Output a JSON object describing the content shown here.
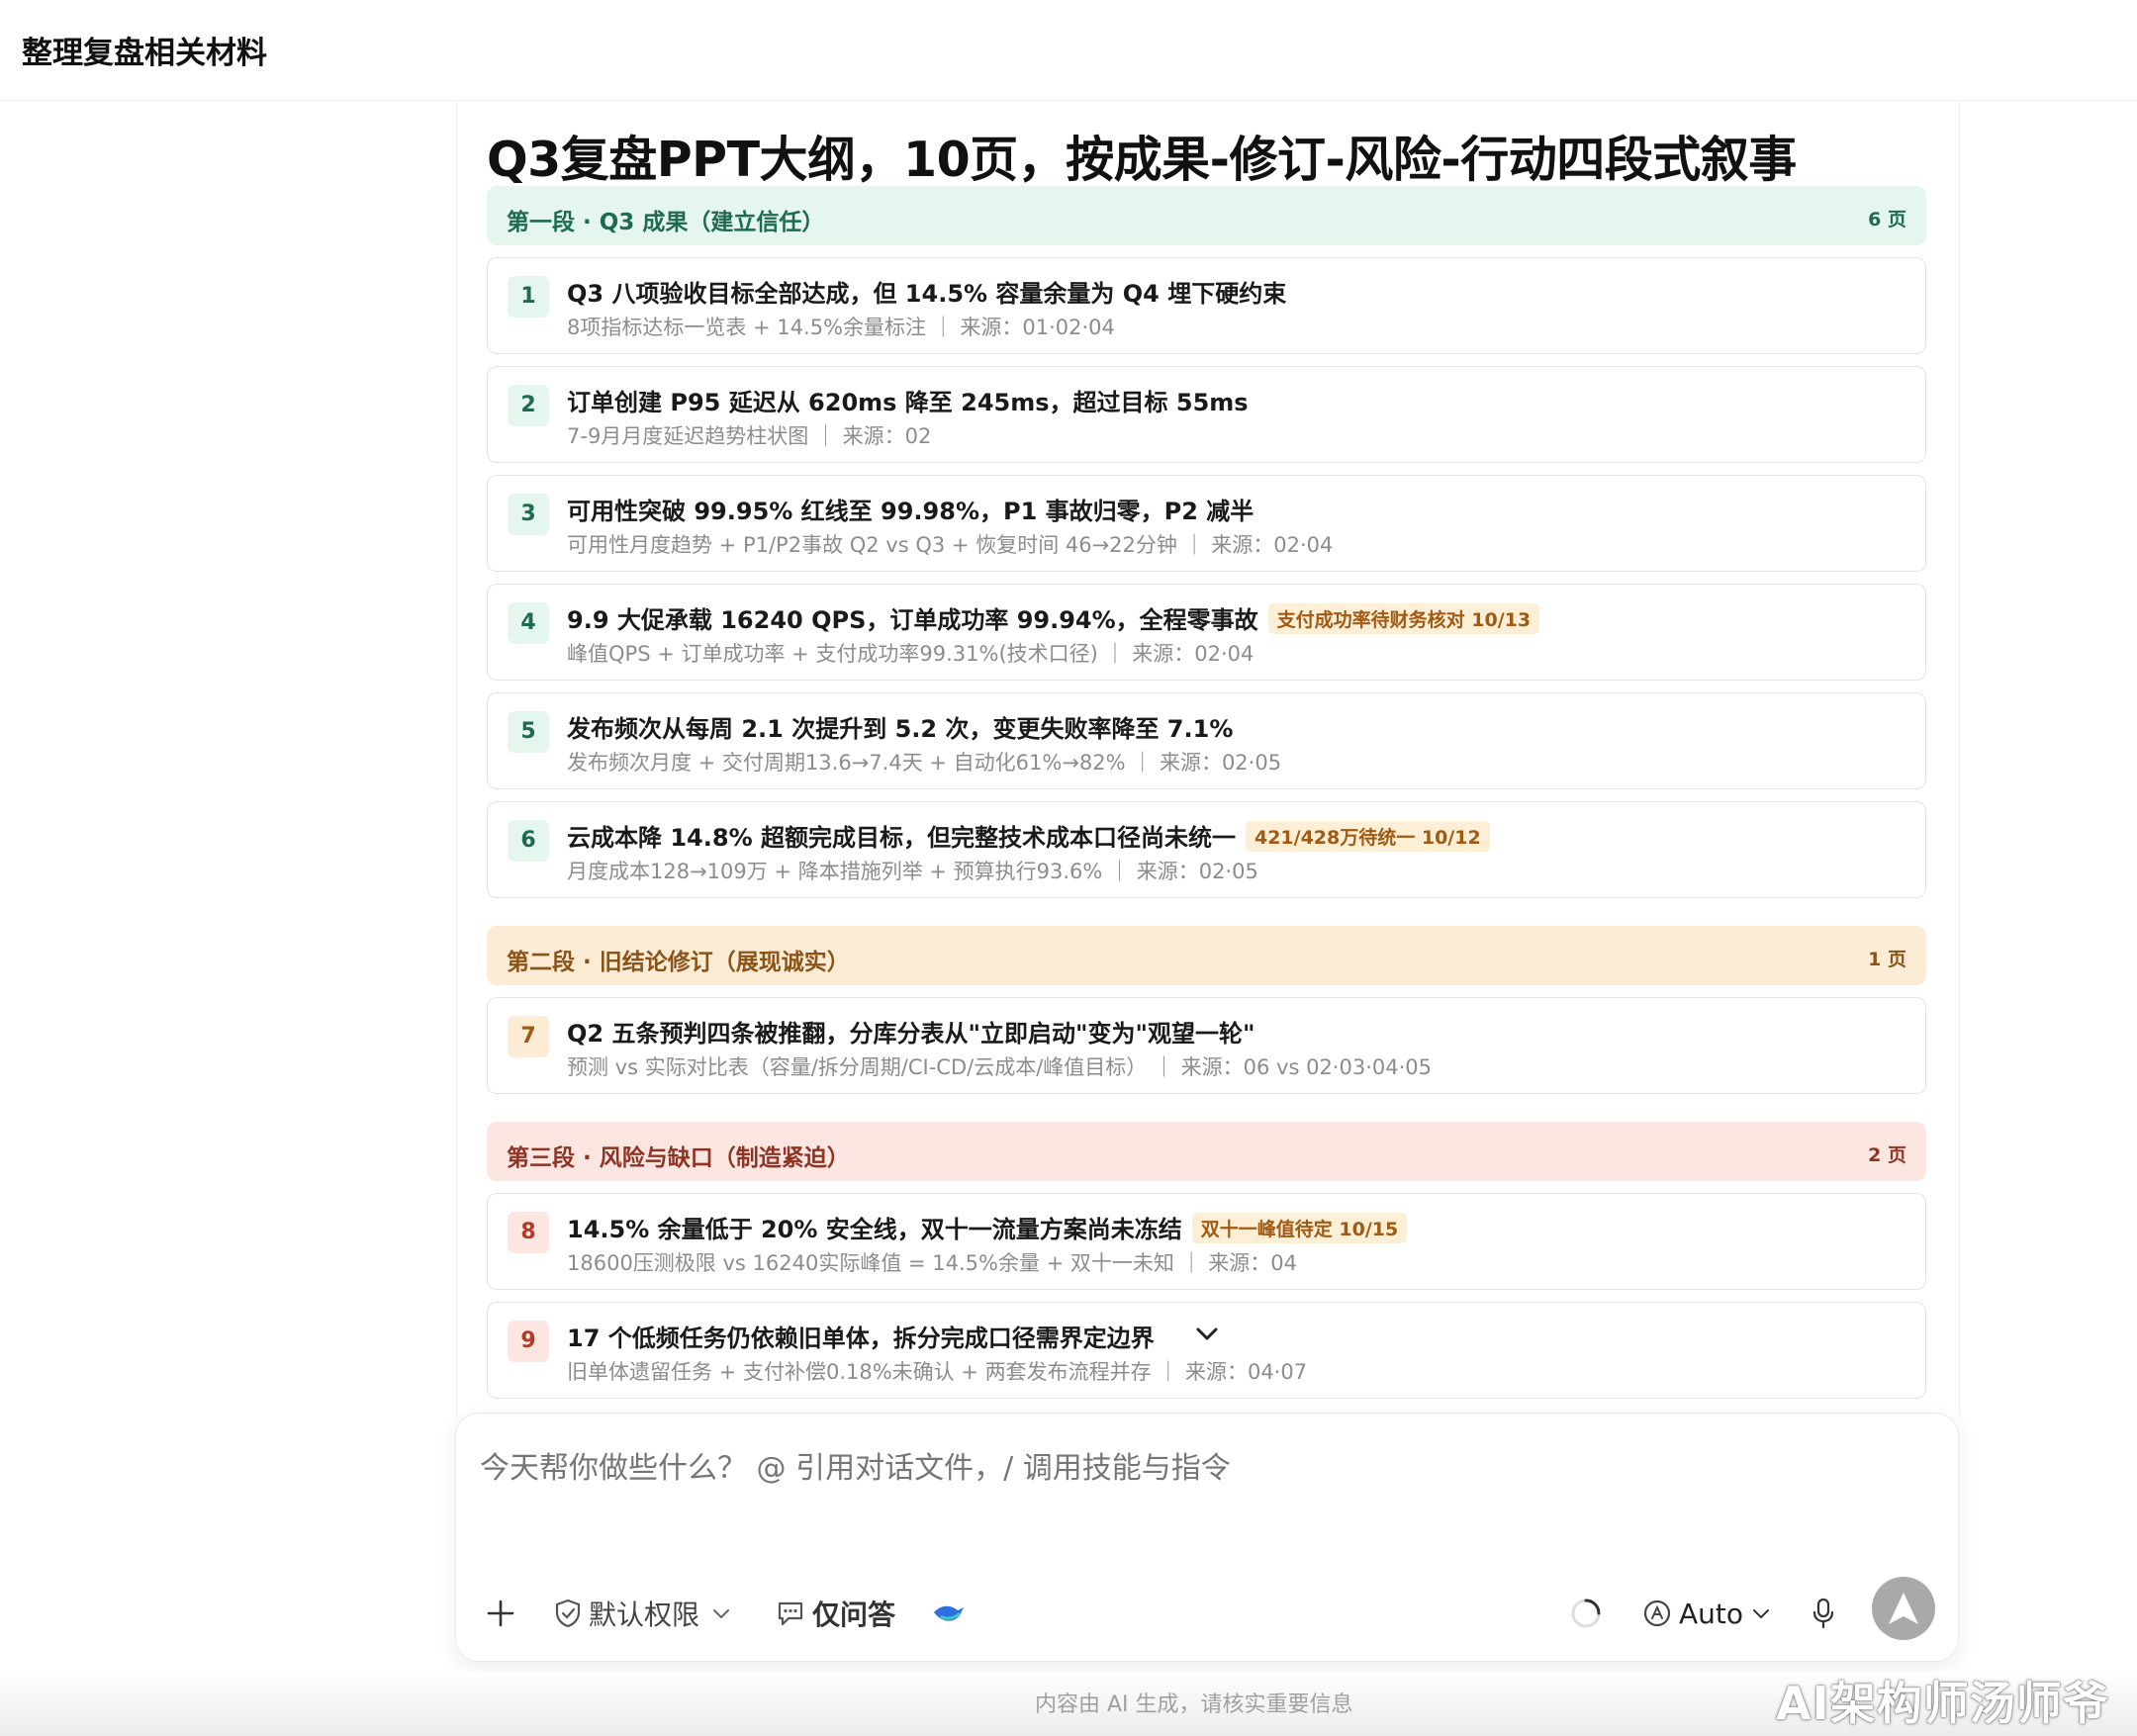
{
  "header": {
    "title": "整理复盘相关材料"
  },
  "doc": {
    "title": "Q3复盘PPT大纲，10页，按成果-修订-风险-行动四段式叙事",
    "sections": [
      {
        "label": "第一段 · Q3 成果（建立信任）",
        "count": "6 页"
      },
      {
        "label": "第二段 · 旧结论修订（展现诚实）",
        "count": "1 页"
      },
      {
        "label": "第三段 · 风险与缺口（制造紧迫）",
        "count": "2 页"
      }
    ],
    "items": [
      {
        "num": "1",
        "title": "Q3 八项验收目标全部达成，但 14.5% 容量余量为 Q4 埋下硬约束",
        "tag": "",
        "sub": "8项指标达标一览表 + 14.5%余量标注 ｜ 来源：01·02·04"
      },
      {
        "num": "2",
        "title": "订单创建 P95 延迟从 620ms 降至 245ms，超过目标 55ms",
        "tag": "",
        "sub": "7-9月月度延迟趋势柱状图 ｜ 来源：02"
      },
      {
        "num": "3",
        "title": "可用性突破 99.95% 红线至 99.98%，P1 事故归零，P2 减半",
        "tag": "",
        "sub": "可用性月度趋势 + P1/P2事故 Q2 vs Q3 + 恢复时间 46→22分钟 ｜ 来源：02·04"
      },
      {
        "num": "4",
        "title": "9.9 大促承载 16240 QPS，订单成功率 99.94%，全程零事故",
        "tag": "支付成功率待财务核对 10/13",
        "sub": "峰值QPS + 订单成功率 + 支付成功率99.31%(技术口径) ｜ 来源：02·04"
      },
      {
        "num": "5",
        "title": "发布频次从每周 2.1 次提升到 5.2 次，变更失败率降至 7.1%",
        "tag": "",
        "sub": "发布频次月度 + 交付周期13.6→7.4天 + 自动化61%→82% ｜ 来源：02·05"
      },
      {
        "num": "6",
        "title": "云成本降 14.8% 超额完成目标，但完整技术成本口径尚未统一",
        "tag": "421/428万待统一 10/12",
        "sub": "月度成本128→109万 + 降本措施列举 + 预算执行93.6% ｜ 来源：02·05"
      },
      {
        "num": "7",
        "title": "Q2 五条预判四条被推翻，分库分表从\"立即启动\"变为\"观望一轮\"",
        "tag": "",
        "sub": "预测 vs 实际对比表（容量/拆分周期/CI-CD/云成本/峰值目标） ｜ 来源：06 vs 02·03·04·05"
      },
      {
        "num": "8",
        "title": "14.5% 余量低于 20% 安全线，双十一流量方案尚未冻结",
        "tag": "双十一峰值待定 10/15",
        "sub": "18600压测极限 vs 16240实际峰值 = 14.5%余量 + 双十一未知 ｜ 来源：04"
      },
      {
        "num": "9",
        "title": "17 个低频任务仍依赖旧单体，拆分完成口径需界定边界",
        "tag": "",
        "sub": "旧单体遗留任务 + 支付补偿0.18%未确认 + 两套发布流程并存 ｜ 来源：04·07"
      }
    ]
  },
  "composer": {
    "placeholder": "今天帮你做些什么？ @ 引用对话文件，/ 调用技能与指令",
    "permission_label": "默认权限",
    "qa_label": "仅问答",
    "model_label": "Auto"
  },
  "footer": {
    "note": "内容由 AI 生成，请核实重要信息"
  },
  "watermark": "AI架构师汤师爷",
  "colors": {
    "section_green": "#e4f6ee",
    "section_orange": "#fcecd5",
    "section_red": "#fce6e1",
    "tag_bg": "#fcefd6",
    "send_button": "#a9a9a9"
  }
}
